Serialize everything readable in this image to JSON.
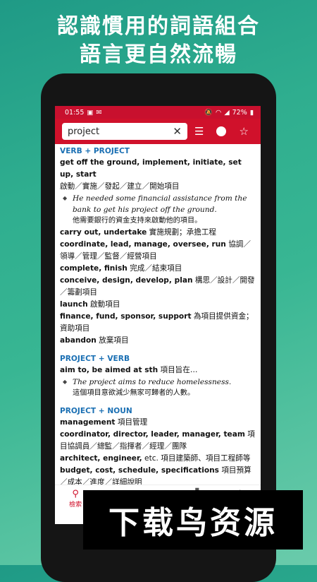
{
  "headline": {
    "line1": "認識慣用的詞語組合",
    "line2": "語言更自然流暢"
  },
  "status_bar": {
    "time": "01:55",
    "battery": "72%"
  },
  "search": {
    "query": "project"
  },
  "sections": [
    {
      "header": "VERB + PROJECT",
      "lines": [
        {
          "b": "get off the ground, implement, initiate, set up, start",
          "t": "啟動／實施／發起／建立／開始項目"
        },
        {
          "example": "He needed some financial assistance from the bank to get his project off the ground.",
          "translation": "他需要銀行的資金支持來啟動他的項目。"
        },
        {
          "b": "carry out, undertake",
          "t": " 實施規劃；承擔工程"
        },
        {
          "b": "coordinate, lead, manage, oversee, run",
          "t": " 協調／領導／管理／監督／經營項目"
        },
        {
          "b": "complete, finish",
          "t": " 完成／結束項目"
        },
        {
          "b": "conceive, design, develop, plan",
          "t": " 構思／設計／開發／籌劃項目"
        },
        {
          "b": "launch",
          "t": " 啟動項目"
        },
        {
          "b": "finance, fund, sponsor, support",
          "t": " 為項目提供資金；資助項目"
        },
        {
          "b": "abandon",
          "t": " 放棄項目"
        }
      ]
    },
    {
      "header": "PROJECT + VERB",
      "lines": [
        {
          "b": "aim to, be aimed at sth",
          "t": " 項目旨在…"
        },
        {
          "example": "The project aims to reduce homelessness.",
          "translation": "這個項目意欲減少無家可歸者的人數。"
        }
      ]
    },
    {
      "header": "PROJECT + NOUN",
      "lines": [
        {
          "b": "management",
          "t": " 項目管理"
        },
        {
          "b": "coordinator, director, leader, manager, team",
          "t": " 項目協調員／總監／指揮者／經理／團隊"
        },
        {
          "b": "architect, engineer,",
          "n": " etc.",
          "t": " 項目建築師、項目工程師等"
        },
        {
          "b": "budget, cost, schedule, specifications",
          "t": " 項目預算／成本／進度／詳細說明"
        }
      ]
    }
  ],
  "bottom_nav": {
    "active_label": "檢索"
  },
  "watermark": "下载鸟资源",
  "colors": {
    "app_red": "#d0112b",
    "header_blue": "#1a6fb3"
  }
}
